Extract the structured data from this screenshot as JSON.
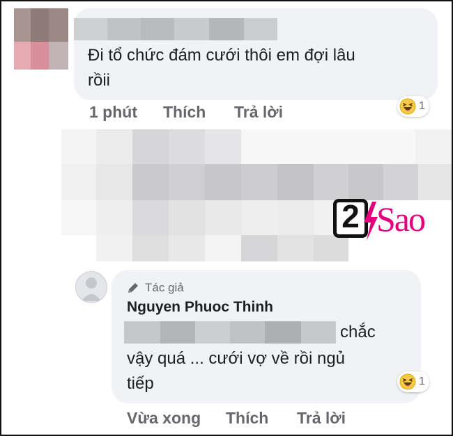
{
  "comment1": {
    "text_line1": "Đi tổ chức đám cưới thôi em đợi lâu",
    "text_line2": "rồii",
    "time": "1 phút",
    "like": "Thích",
    "reply": "Trả lời",
    "reaction_count": "1",
    "reaction_icon": "haha-emoji-icon"
  },
  "watermark": {
    "number": "2",
    "word": "Sao",
    "accent_color": "#e3007a"
  },
  "reply1": {
    "author_badge": "Tác giả",
    "author_name": "Nguyen Phuoc Thinh",
    "text_line1_tail": "chắc",
    "text_line2": "vậy quá ... cưới vợ về rồi ngủ",
    "text_line3": "tiếp",
    "time": "Vừa xong",
    "like": "Thích",
    "reply": "Trả lời",
    "reaction_count": "1",
    "reaction_icon": "haha-emoji-icon"
  }
}
